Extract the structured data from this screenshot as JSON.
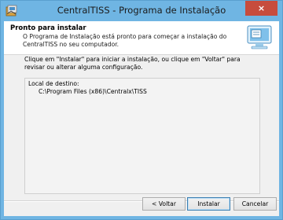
{
  "window": {
    "title": "CentralTISS - Programa de Instalação",
    "close_label": "×"
  },
  "header": {
    "title": "Pronto para instalar",
    "subtitle": "O Programa de Instalação está pronto para começar a instalação do CentralTISS no seu computador."
  },
  "body": {
    "instructions": "Clique em \"Instalar\" para iniciar a instalação, ou clique em \"Voltar\" para revisar ou alterar alguma configuração.",
    "memo_label": "Local de destino:",
    "memo_path": "C:\\Program Files (x86)\\Centralx\\TISS"
  },
  "buttons": {
    "back": "< Voltar",
    "install": "Instalar",
    "cancel": "Cancelar"
  },
  "colors": {
    "frame": "#6fb5e3",
    "close": "#c74c3d"
  }
}
